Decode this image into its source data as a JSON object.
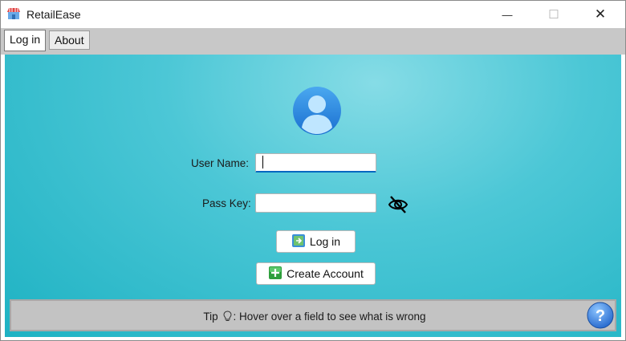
{
  "window": {
    "title": "RetailEase",
    "minimize_glyph": "—",
    "maximize_glyph": "☐",
    "close_glyph": "✕"
  },
  "tabs": [
    {
      "label": "Log in",
      "active": true
    },
    {
      "label": "About",
      "active": false
    }
  ],
  "login": {
    "username_label": "User Name:",
    "username_value": "",
    "passkey_label": "Pass Key:",
    "passkey_value": "",
    "login_button": "Log in",
    "create_account_button": "Create Account"
  },
  "tip": {
    "prefix": "Tip",
    "message": ": Hover over a field to see what is wrong"
  },
  "icons": {
    "app": "store-icon",
    "avatar": "user-avatar-icon",
    "eye": "eye-hidden-icon",
    "login": "login-icon",
    "create": "add-user-icon",
    "tip": "lightbulb-icon",
    "help": "help-icon"
  },
  "colors": {
    "accent": "#0067c0",
    "content_bg": "#34bccd",
    "tipbar_bg": "#c3c3c3"
  }
}
